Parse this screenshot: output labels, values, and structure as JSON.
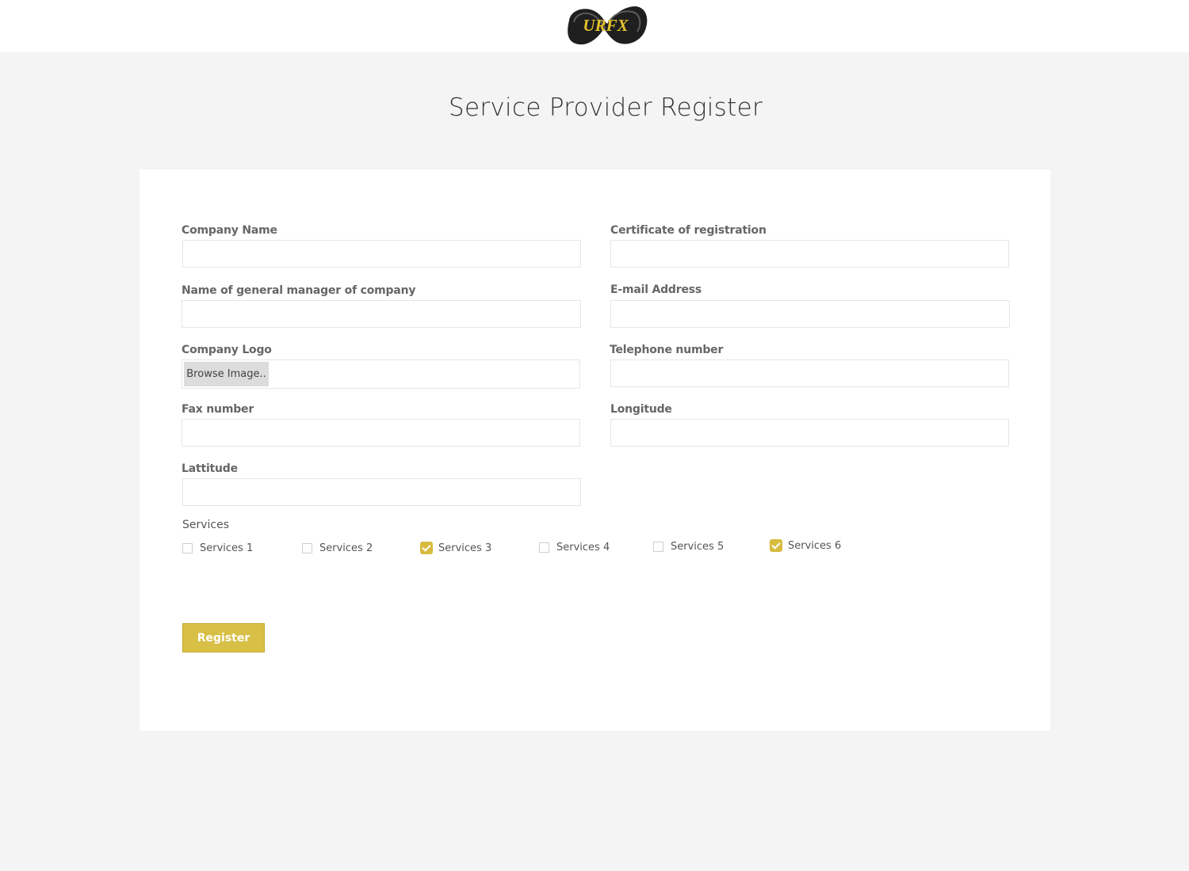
{
  "brand": {
    "logo_text": "URFX",
    "accent_color": "#d8bf46"
  },
  "page": {
    "title": "Service Provider Register"
  },
  "form": {
    "company_name": {
      "label": "Company Name",
      "value": ""
    },
    "certificate": {
      "label": "Certificate of registration",
      "value": ""
    },
    "general_manager": {
      "label": "Name of general manager of company",
      "value": ""
    },
    "email": {
      "label": "E-mail Address",
      "value": ""
    },
    "company_logo": {
      "label": "Company Logo",
      "browse_label": "Browse Image.."
    },
    "telephone": {
      "label": "Telephone number",
      "value": ""
    },
    "fax": {
      "label": "Fax number",
      "value": ""
    },
    "longitude": {
      "label": "Longitude",
      "value": ""
    },
    "latitude": {
      "label": "Lattitude",
      "value": ""
    }
  },
  "services": {
    "title": "Services",
    "items": [
      {
        "label": "Services 1",
        "checked": false
      },
      {
        "label": "Services 2",
        "checked": false
      },
      {
        "label": "Services 3",
        "checked": true
      },
      {
        "label": "Services 4",
        "checked": false
      },
      {
        "label": "Services 5",
        "checked": false
      },
      {
        "label": "Services 6",
        "checked": true
      }
    ]
  },
  "actions": {
    "register_label": "Register"
  }
}
